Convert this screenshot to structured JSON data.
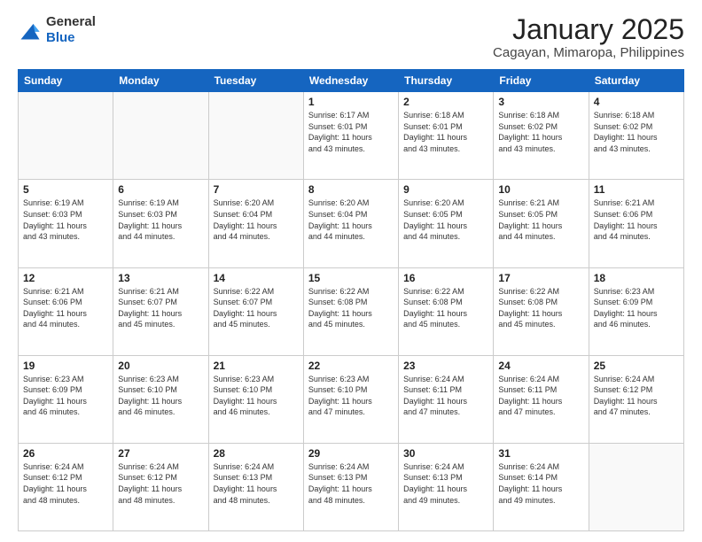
{
  "logo": {
    "general": "General",
    "blue": "Blue"
  },
  "title": "January 2025",
  "subtitle": "Cagayan, Mimaropa, Philippines",
  "days_header": [
    "Sunday",
    "Monday",
    "Tuesday",
    "Wednesday",
    "Thursday",
    "Friday",
    "Saturday"
  ],
  "weeks": [
    [
      {
        "day": "",
        "info": ""
      },
      {
        "day": "",
        "info": ""
      },
      {
        "day": "",
        "info": ""
      },
      {
        "day": "1",
        "info": "Sunrise: 6:17 AM\nSunset: 6:01 PM\nDaylight: 11 hours\nand 43 minutes."
      },
      {
        "day": "2",
        "info": "Sunrise: 6:18 AM\nSunset: 6:01 PM\nDaylight: 11 hours\nand 43 minutes."
      },
      {
        "day": "3",
        "info": "Sunrise: 6:18 AM\nSunset: 6:02 PM\nDaylight: 11 hours\nand 43 minutes."
      },
      {
        "day": "4",
        "info": "Sunrise: 6:18 AM\nSunset: 6:02 PM\nDaylight: 11 hours\nand 43 minutes."
      }
    ],
    [
      {
        "day": "5",
        "info": "Sunrise: 6:19 AM\nSunset: 6:03 PM\nDaylight: 11 hours\nand 43 minutes."
      },
      {
        "day": "6",
        "info": "Sunrise: 6:19 AM\nSunset: 6:03 PM\nDaylight: 11 hours\nand 44 minutes."
      },
      {
        "day": "7",
        "info": "Sunrise: 6:20 AM\nSunset: 6:04 PM\nDaylight: 11 hours\nand 44 minutes."
      },
      {
        "day": "8",
        "info": "Sunrise: 6:20 AM\nSunset: 6:04 PM\nDaylight: 11 hours\nand 44 minutes."
      },
      {
        "day": "9",
        "info": "Sunrise: 6:20 AM\nSunset: 6:05 PM\nDaylight: 11 hours\nand 44 minutes."
      },
      {
        "day": "10",
        "info": "Sunrise: 6:21 AM\nSunset: 6:05 PM\nDaylight: 11 hours\nand 44 minutes."
      },
      {
        "day": "11",
        "info": "Sunrise: 6:21 AM\nSunset: 6:06 PM\nDaylight: 11 hours\nand 44 minutes."
      }
    ],
    [
      {
        "day": "12",
        "info": "Sunrise: 6:21 AM\nSunset: 6:06 PM\nDaylight: 11 hours\nand 44 minutes."
      },
      {
        "day": "13",
        "info": "Sunrise: 6:21 AM\nSunset: 6:07 PM\nDaylight: 11 hours\nand 45 minutes."
      },
      {
        "day": "14",
        "info": "Sunrise: 6:22 AM\nSunset: 6:07 PM\nDaylight: 11 hours\nand 45 minutes."
      },
      {
        "day": "15",
        "info": "Sunrise: 6:22 AM\nSunset: 6:08 PM\nDaylight: 11 hours\nand 45 minutes."
      },
      {
        "day": "16",
        "info": "Sunrise: 6:22 AM\nSunset: 6:08 PM\nDaylight: 11 hours\nand 45 minutes."
      },
      {
        "day": "17",
        "info": "Sunrise: 6:22 AM\nSunset: 6:08 PM\nDaylight: 11 hours\nand 45 minutes."
      },
      {
        "day": "18",
        "info": "Sunrise: 6:23 AM\nSunset: 6:09 PM\nDaylight: 11 hours\nand 46 minutes."
      }
    ],
    [
      {
        "day": "19",
        "info": "Sunrise: 6:23 AM\nSunset: 6:09 PM\nDaylight: 11 hours\nand 46 minutes."
      },
      {
        "day": "20",
        "info": "Sunrise: 6:23 AM\nSunset: 6:10 PM\nDaylight: 11 hours\nand 46 minutes."
      },
      {
        "day": "21",
        "info": "Sunrise: 6:23 AM\nSunset: 6:10 PM\nDaylight: 11 hours\nand 46 minutes."
      },
      {
        "day": "22",
        "info": "Sunrise: 6:23 AM\nSunset: 6:10 PM\nDaylight: 11 hours\nand 47 minutes."
      },
      {
        "day": "23",
        "info": "Sunrise: 6:24 AM\nSunset: 6:11 PM\nDaylight: 11 hours\nand 47 minutes."
      },
      {
        "day": "24",
        "info": "Sunrise: 6:24 AM\nSunset: 6:11 PM\nDaylight: 11 hours\nand 47 minutes."
      },
      {
        "day": "25",
        "info": "Sunrise: 6:24 AM\nSunset: 6:12 PM\nDaylight: 11 hours\nand 47 minutes."
      }
    ],
    [
      {
        "day": "26",
        "info": "Sunrise: 6:24 AM\nSunset: 6:12 PM\nDaylight: 11 hours\nand 48 minutes."
      },
      {
        "day": "27",
        "info": "Sunrise: 6:24 AM\nSunset: 6:12 PM\nDaylight: 11 hours\nand 48 minutes."
      },
      {
        "day": "28",
        "info": "Sunrise: 6:24 AM\nSunset: 6:13 PM\nDaylight: 11 hours\nand 48 minutes."
      },
      {
        "day": "29",
        "info": "Sunrise: 6:24 AM\nSunset: 6:13 PM\nDaylight: 11 hours\nand 48 minutes."
      },
      {
        "day": "30",
        "info": "Sunrise: 6:24 AM\nSunset: 6:13 PM\nDaylight: 11 hours\nand 49 minutes."
      },
      {
        "day": "31",
        "info": "Sunrise: 6:24 AM\nSunset: 6:14 PM\nDaylight: 11 hours\nand 49 minutes."
      },
      {
        "day": "",
        "info": ""
      }
    ]
  ]
}
